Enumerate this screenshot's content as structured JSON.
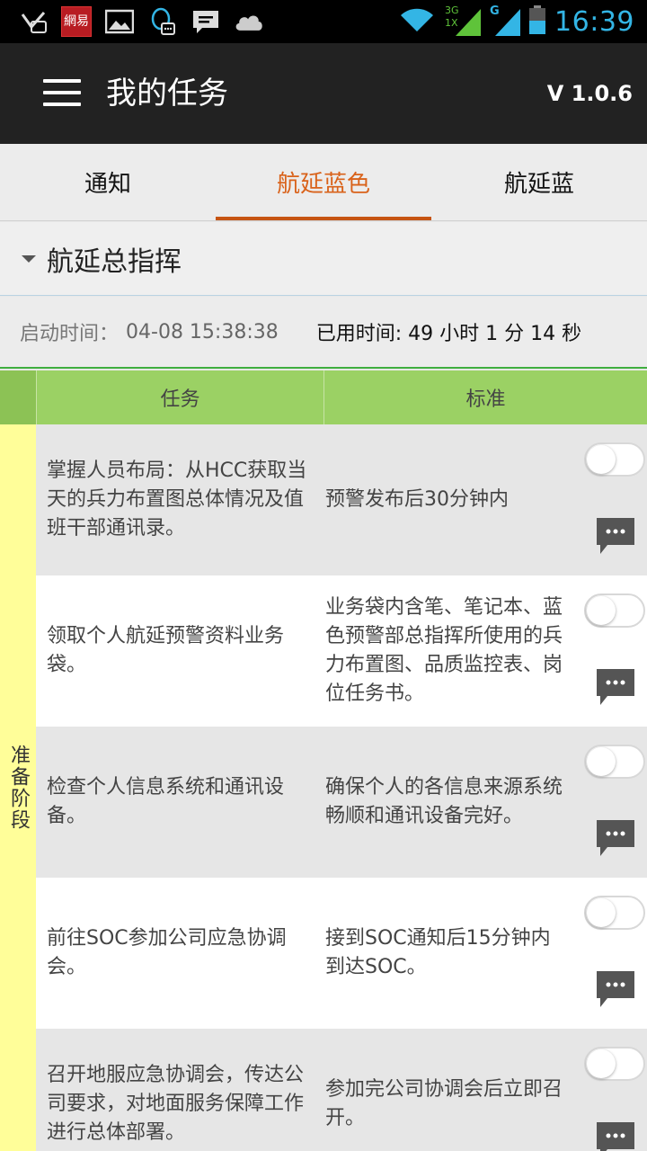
{
  "status_bar": {
    "time": "16:39",
    "network_3g": "3G",
    "network_1x": "1X",
    "network_g": "G",
    "app_badge": "網易"
  },
  "app_bar": {
    "title": "我的任务",
    "version": "V 1.0.6"
  },
  "tabs": [
    {
      "label": "通知",
      "active": false
    },
    {
      "label": "航延蓝色",
      "active": true
    },
    {
      "label": "航延蓝",
      "active": false
    }
  ],
  "section": {
    "title": "航延总指挥"
  },
  "time_info": {
    "start_label": "启动时间：",
    "start_value": "04-08 15:38:38",
    "elapsed": "已用时间: 49 小时 1 分 14 秒"
  },
  "table": {
    "headers": {
      "task": "任务",
      "standard": "标准"
    },
    "phase": "准备阶段",
    "rows": [
      {
        "task": "掌握人员布局：从HCC获取当天的兵力布置图总体情况及值班干部通讯录。",
        "standard": "预警发布后30分钟内"
      },
      {
        "task": "领取个人航延预警资料业务袋。",
        "standard": "业务袋内含笔、笔记本、蓝色预警部总指挥所使用的兵力布置图、品质监控表、岗位任务书。"
      },
      {
        "task": "检查个人信息系统和通讯设备。",
        "standard": "确保个人的各信息来源系统畅顺和通讯设备完好。"
      },
      {
        "task": "前往SOC参加公司应急协调会。",
        "standard": "接到SOC通知后15分钟内到达SOC。"
      },
      {
        "task": "召开地服应急协调会，传达公司要求，对地面服务保障工作进行总体部署。",
        "standard": "参加完公司协调会后立即召开。"
      }
    ]
  },
  "colors": {
    "accent": "#d9621a",
    "header_green": "#9bd164",
    "phase_yellow": "#fffe99",
    "status_blue": "#33b5e5"
  }
}
